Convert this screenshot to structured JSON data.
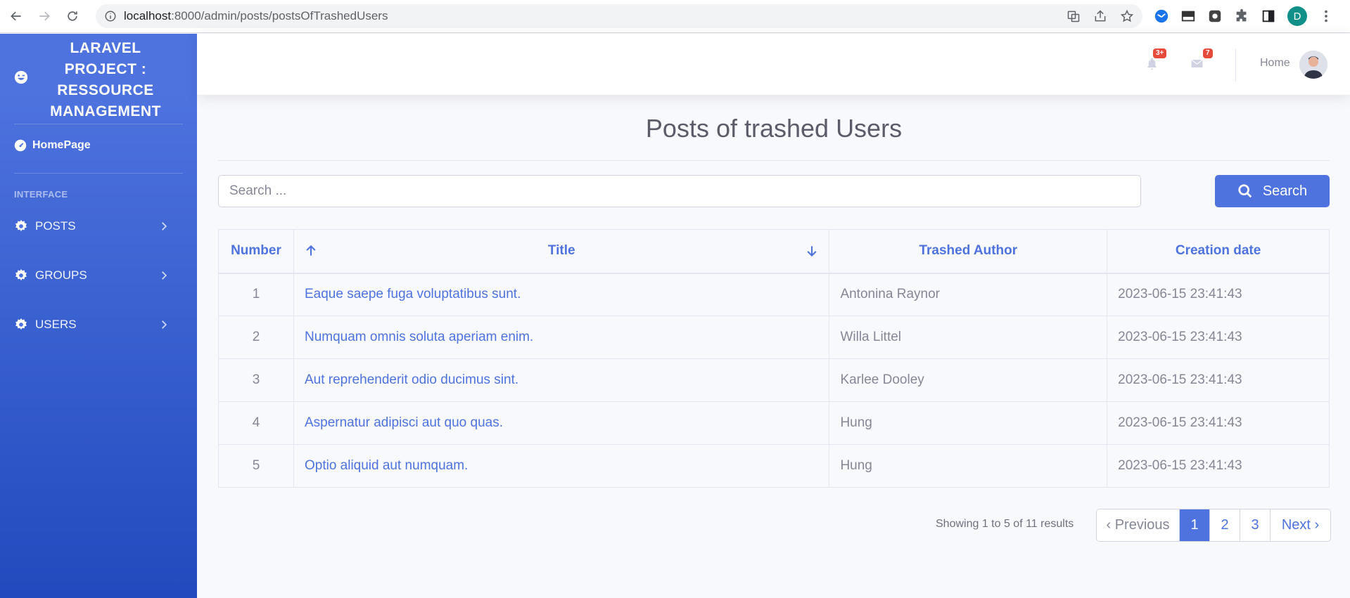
{
  "browser": {
    "url_host": "localhost",
    "url_path": ":8000/admin/posts/postsOfTrashedUsers",
    "profile_initial": "D"
  },
  "sidebar": {
    "brand": "LARAVEL PROJECT : RESSOURCE MANAGEMENT",
    "home_label": "HomePage",
    "heading": "INTERFACE",
    "items": [
      {
        "label": "POSTS"
      },
      {
        "label": "GROUPS"
      },
      {
        "label": "USERS"
      }
    ]
  },
  "topbar": {
    "alerts_count": "3+",
    "messages_count": "7",
    "user_label": "Home"
  },
  "main": {
    "title": "Posts of trashed Users",
    "search_placeholder": "Search ...",
    "search_button": "Search",
    "table": {
      "headers": [
        "Number",
        "Title",
        "Trashed Author",
        "Creation date"
      ],
      "rows": [
        {
          "number": "1",
          "title": "Eaque saepe fuga voluptatibus sunt.",
          "author": "Antonina Raynor",
          "date": "2023-06-15 23:41:43"
        },
        {
          "number": "2",
          "title": "Numquam omnis soluta aperiam enim.",
          "author": "Willa Littel",
          "date": "2023-06-15 23:41:43"
        },
        {
          "number": "3",
          "title": "Aut reprehenderit odio ducimus sint.",
          "author": "Karlee Dooley",
          "date": "2023-06-15 23:41:43"
        },
        {
          "number": "4",
          "title": "Aspernatur adipisci aut quo quas.",
          "author": "Hung",
          "date": "2023-06-15 23:41:43"
        },
        {
          "number": "5",
          "title": "Optio aliquid aut numquam.",
          "author": "Hung",
          "date": "2023-06-15 23:41:43"
        }
      ]
    },
    "showing": "Showing 1 to 5 of 11 results",
    "pagination": {
      "previous": "‹ Previous",
      "pages": [
        "1",
        "2",
        "3"
      ],
      "current": "1",
      "next": "Next ›"
    }
  },
  "colors": {
    "primary": "#4e73df",
    "sidebar_end": "#224abe",
    "badge": "#e74a3b"
  }
}
